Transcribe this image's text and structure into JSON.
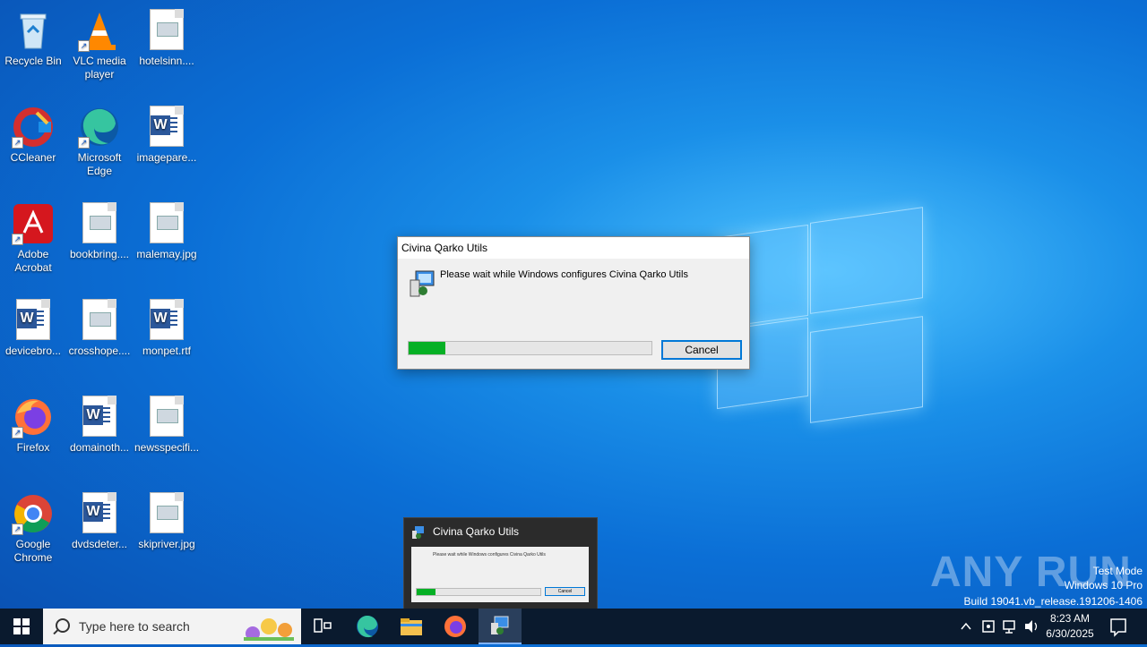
{
  "desktop": {
    "icons": [
      {
        "label": "Recycle Bin"
      },
      {
        "label": "VLC media player"
      },
      {
        "label": "hotelsinn...."
      },
      {
        "label": "CCleaner"
      },
      {
        "label": "Microsoft Edge"
      },
      {
        "label": "imagepare..."
      },
      {
        "label": "Adobe Acrobat"
      },
      {
        "label": "bookbring...."
      },
      {
        "label": "malemay.jpg"
      },
      {
        "label": "devicebro..."
      },
      {
        "label": "crosshope...."
      },
      {
        "label": "monpet.rtf"
      },
      {
        "label": "Firefox"
      },
      {
        "label": "domainoth..."
      },
      {
        "label": "newsspecifi..."
      },
      {
        "label": "Google Chrome"
      },
      {
        "label": "dvdsdeter..."
      },
      {
        "label": "skipriver.jpg"
      }
    ]
  },
  "dialog": {
    "title": "Civina Qarko Utils",
    "message": "Please wait while Windows configures Civina Qarko Utils",
    "progress": 0.15,
    "cancel_label": "Cancel"
  },
  "thumbnail": {
    "title": "Civina Qarko Utils",
    "message": "Please wait while Windows configures Civina Qarko Utils",
    "cancel_label": "Cancel"
  },
  "watermark": {
    "brand": "ANY RUN",
    "line1": "Test Mode",
    "line2": "Windows 10 Pro",
    "line3": "Build 19041.vb_release.191206-1406"
  },
  "taskbar": {
    "search_placeholder": "Type here to search",
    "time": "8:23 AM",
    "date": "6/30/2025"
  },
  "colors": {
    "accent": "#0078d7",
    "progress": "#06b025",
    "taskbar": "#0a1a2e"
  }
}
